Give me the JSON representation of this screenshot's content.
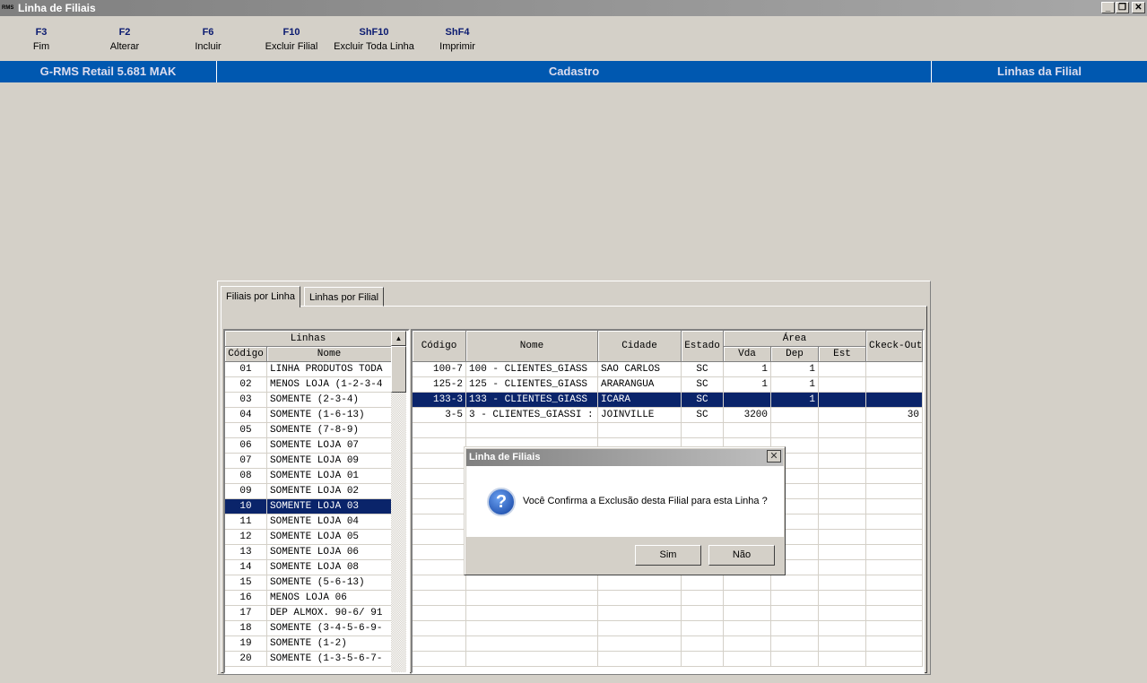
{
  "window": {
    "title": "Linha de Filiais",
    "icon_text": "RMS"
  },
  "toolbar": [
    {
      "key": "F3",
      "label": "Fim"
    },
    {
      "key": "F2",
      "label": "Alterar"
    },
    {
      "key": "F6",
      "label": "Incluir"
    },
    {
      "key": "F10",
      "label": "Excluir Filial"
    },
    {
      "key": "ShF10",
      "label": "Excluir Toda Linha"
    },
    {
      "key": "ShF4",
      "label": "Imprimir"
    }
  ],
  "statusbar": {
    "app": "G-RMS Retail 5.681 MAK",
    "module": "Cadastro",
    "screen": "Linhas da Filial"
  },
  "tabs": [
    {
      "label": "Filiais por Linha",
      "active": true
    },
    {
      "label": "Linhas por Filial",
      "active": false
    }
  ],
  "linhas": {
    "group_header": "Linhas",
    "columns": [
      "Código",
      "Nome"
    ],
    "selected_index": 9,
    "rows": [
      [
        "01",
        "LINHA PRODUTOS TODA"
      ],
      [
        "02",
        "MENOS LOJA (1-2-3-4"
      ],
      [
        "03",
        "SOMENTE (2-3-4)"
      ],
      [
        "04",
        "SOMENTE (1-6-13)"
      ],
      [
        "05",
        "SOMENTE (7-8-9)"
      ],
      [
        "06",
        "SOMENTE LOJA 07"
      ],
      [
        "07",
        "SOMENTE LOJA 09"
      ],
      [
        "08",
        "SOMENTE LOJA 01"
      ],
      [
        "09",
        "SOMENTE LOJA 02"
      ],
      [
        "10",
        "SOMENTE LOJA 03"
      ],
      [
        "11",
        "SOMENTE LOJA 04"
      ],
      [
        "12",
        "SOMENTE LOJA 05"
      ],
      [
        "13",
        "SOMENTE LOJA 06"
      ],
      [
        "14",
        "SOMENTE LOJA 08"
      ],
      [
        "15",
        "SOMENTE (5-6-13)"
      ],
      [
        "16",
        "MENOS LOJA 06"
      ],
      [
        "17",
        "DEP ALMOX. 90-6/ 91"
      ],
      [
        "18",
        "SOMENTE (3-4-5-6-9-"
      ],
      [
        "19",
        "SOMENTE (1-2)"
      ],
      [
        "20",
        "SOMENTE (1-3-5-6-7-"
      ]
    ]
  },
  "filiais": {
    "columns": [
      "Código",
      "Nome",
      "Cidade",
      "Estado",
      "Vda",
      "Dep",
      "Est",
      "Ckeck-Out"
    ],
    "area_header": "Área",
    "selected_index": 2,
    "rows": [
      [
        "100-7",
        "100 - CLIENTES_GIASS",
        "SAO CARLOS",
        "SC",
        "1",
        "1",
        "",
        ""
      ],
      [
        "125-2",
        "125 - CLIENTES_GIASS",
        "ARARANGUA",
        "SC",
        "1",
        "1",
        "",
        ""
      ],
      [
        "133-3",
        "133 - CLIENTES_GIASS",
        "ICARA",
        "SC",
        "",
        "1",
        "",
        ""
      ],
      [
        "3-5",
        "3 - CLIENTES_GIASSI :",
        "JOINVILLE",
        "SC",
        "3200",
        "",
        "",
        "30"
      ]
    ]
  },
  "dialog": {
    "title": "Linha de Filiais",
    "message": "Você Confirma a Exclusão desta Filial para esta Linha ?",
    "yes": "Sim",
    "no": "Não",
    "icon": "question-icon"
  }
}
